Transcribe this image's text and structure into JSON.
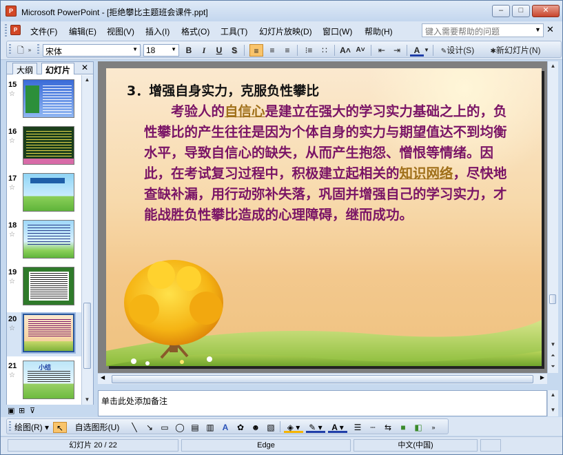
{
  "window": {
    "app_icon_text": "P",
    "title": "Microsoft PowerPoint - [拒绝攀比主题班会课件.ppt]",
    "min": "–",
    "max": "□",
    "close": "✕"
  },
  "menu": {
    "items": [
      "文件(F)",
      "编辑(E)",
      "视图(V)",
      "插入(I)",
      "格式(O)",
      "工具(T)",
      "幻灯片放映(D)",
      "窗口(W)",
      "帮助(H)"
    ],
    "help_placeholder": "键入需要帮助的问题",
    "close": "✕"
  },
  "format_toolbar": {
    "font": "宋体",
    "size": "18",
    "bold": "B",
    "italic": "I",
    "underline": "U",
    "shadow": "S",
    "design": "设计(S)",
    "new_slide": "新幻灯片(N)"
  },
  "left_pane": {
    "tab_outline": "大纲",
    "tab_slides": "幻灯片",
    "close": "✕",
    "slides": [
      {
        "num": "15",
        "star": "☆"
      },
      {
        "num": "16",
        "star": "☆"
      },
      {
        "num": "17",
        "star": "☆"
      },
      {
        "num": "18",
        "star": "☆"
      },
      {
        "num": "19",
        "star": "☆"
      },
      {
        "num": "20",
        "star": "☆"
      },
      {
        "num": "21",
        "star": "☆"
      }
    ],
    "thumb21_title": "小结"
  },
  "slide": {
    "heading": "3．增强自身实力，克服负性攀比",
    "p1": "　　考验人的",
    "link1": "自信心",
    "p2": "是建立在强大的学习实力基础之上的，负性攀比的产生往往是因为个体自身的实力与期望值达不到均衡水平，导致自信心的缺失，从而产生抱怨、憎恨等情绪。因此，在考试复习过程中，积极建立起相关的",
    "link2": "知识网络",
    "p3": "，尽快地查缺补漏，用行动弥补失落，巩固并增强自己的学习实力，才能战胜负性攀比造成的心理障碍，继而成功。"
  },
  "notes": {
    "placeholder": "单击此处添加备注"
  },
  "drawing_toolbar": {
    "draw": "绘图(R)",
    "autoshapes": "自选图形(U)"
  },
  "status": {
    "slide": "幻灯片 20 / 22",
    "design": "Edge",
    "language": "中文(中国)"
  },
  "colors": {
    "body_text": "#7a1466",
    "link": "#a0701a",
    "chrome": "#dbe6f4"
  }
}
